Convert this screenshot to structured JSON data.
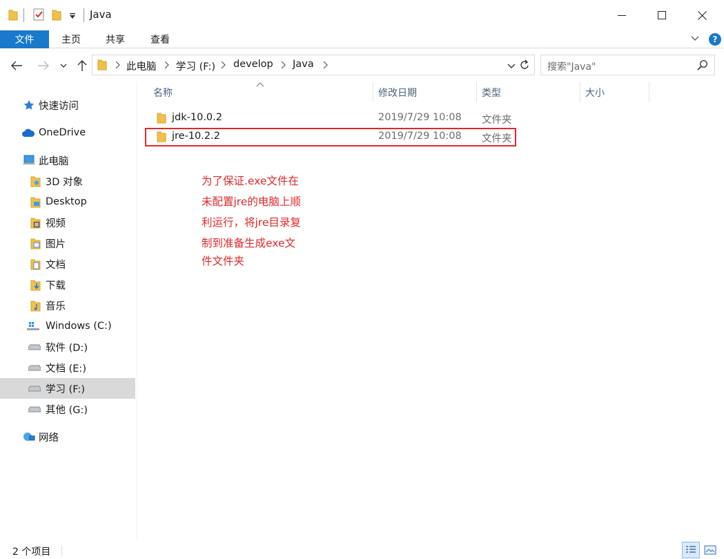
{
  "window": {
    "title": "Java"
  },
  "ribbon": {
    "file": "文件",
    "home": "主页",
    "share": "共享",
    "view": "查看",
    "help": "?"
  },
  "address": {
    "crumbs": [
      "此电脑",
      "学习 (F:)",
      "develop",
      "Java"
    ]
  },
  "search": {
    "placeholder": "搜索\"Java\""
  },
  "sidebar": {
    "items": [
      {
        "label": "快速访问",
        "icon": "star-icon"
      },
      {
        "label": "OneDrive",
        "icon": "cloud-icon"
      },
      {
        "label": "此电脑",
        "icon": "computer-icon"
      },
      {
        "label": "3D 对象",
        "icon": "3d-objects-icon"
      },
      {
        "label": "Desktop",
        "icon": "desktop-folder-icon"
      },
      {
        "label": "视频",
        "icon": "video-folder-icon"
      },
      {
        "label": "图片",
        "icon": "pictures-folder-icon"
      },
      {
        "label": "文档",
        "icon": "documents-folder-icon"
      },
      {
        "label": "下载",
        "icon": "downloads-folder-icon"
      },
      {
        "label": "音乐",
        "icon": "music-folder-icon"
      },
      {
        "label": "Windows (C:)",
        "icon": "windows-drive-icon"
      },
      {
        "label": "软件 (D:)",
        "icon": "drive-icon"
      },
      {
        "label": "文档 (E:)",
        "icon": "drive-icon"
      },
      {
        "label": "学习 (F:)",
        "icon": "drive-icon",
        "selected": true
      },
      {
        "label": "其他 (G:)",
        "icon": "drive-icon"
      },
      {
        "label": "网络",
        "icon": "network-icon"
      }
    ]
  },
  "columns": {
    "name": "名称",
    "modified": "修改日期",
    "type": "类型",
    "size": "大小"
  },
  "files": [
    {
      "name": "jdk-10.0.2",
      "modified": "2019/7/29 10:08",
      "type": "文件夹"
    },
    {
      "name": "jre-10.2.2",
      "modified": "2019/7/29 10:08",
      "type": "文件夹"
    }
  ],
  "annotation": {
    "lines": [
      "为了保证.exe文件在",
      "未配置jre的电脑上顺",
      "利运行，将jre目录复",
      "制到准备生成exe文",
      "件文件夹"
    ],
    "color": "#e0272b"
  },
  "status": {
    "count": "2 个项目"
  },
  "colors": {
    "accent": "#1979ca",
    "highlight": "#e0272b",
    "selected": "#d9d9d9"
  }
}
